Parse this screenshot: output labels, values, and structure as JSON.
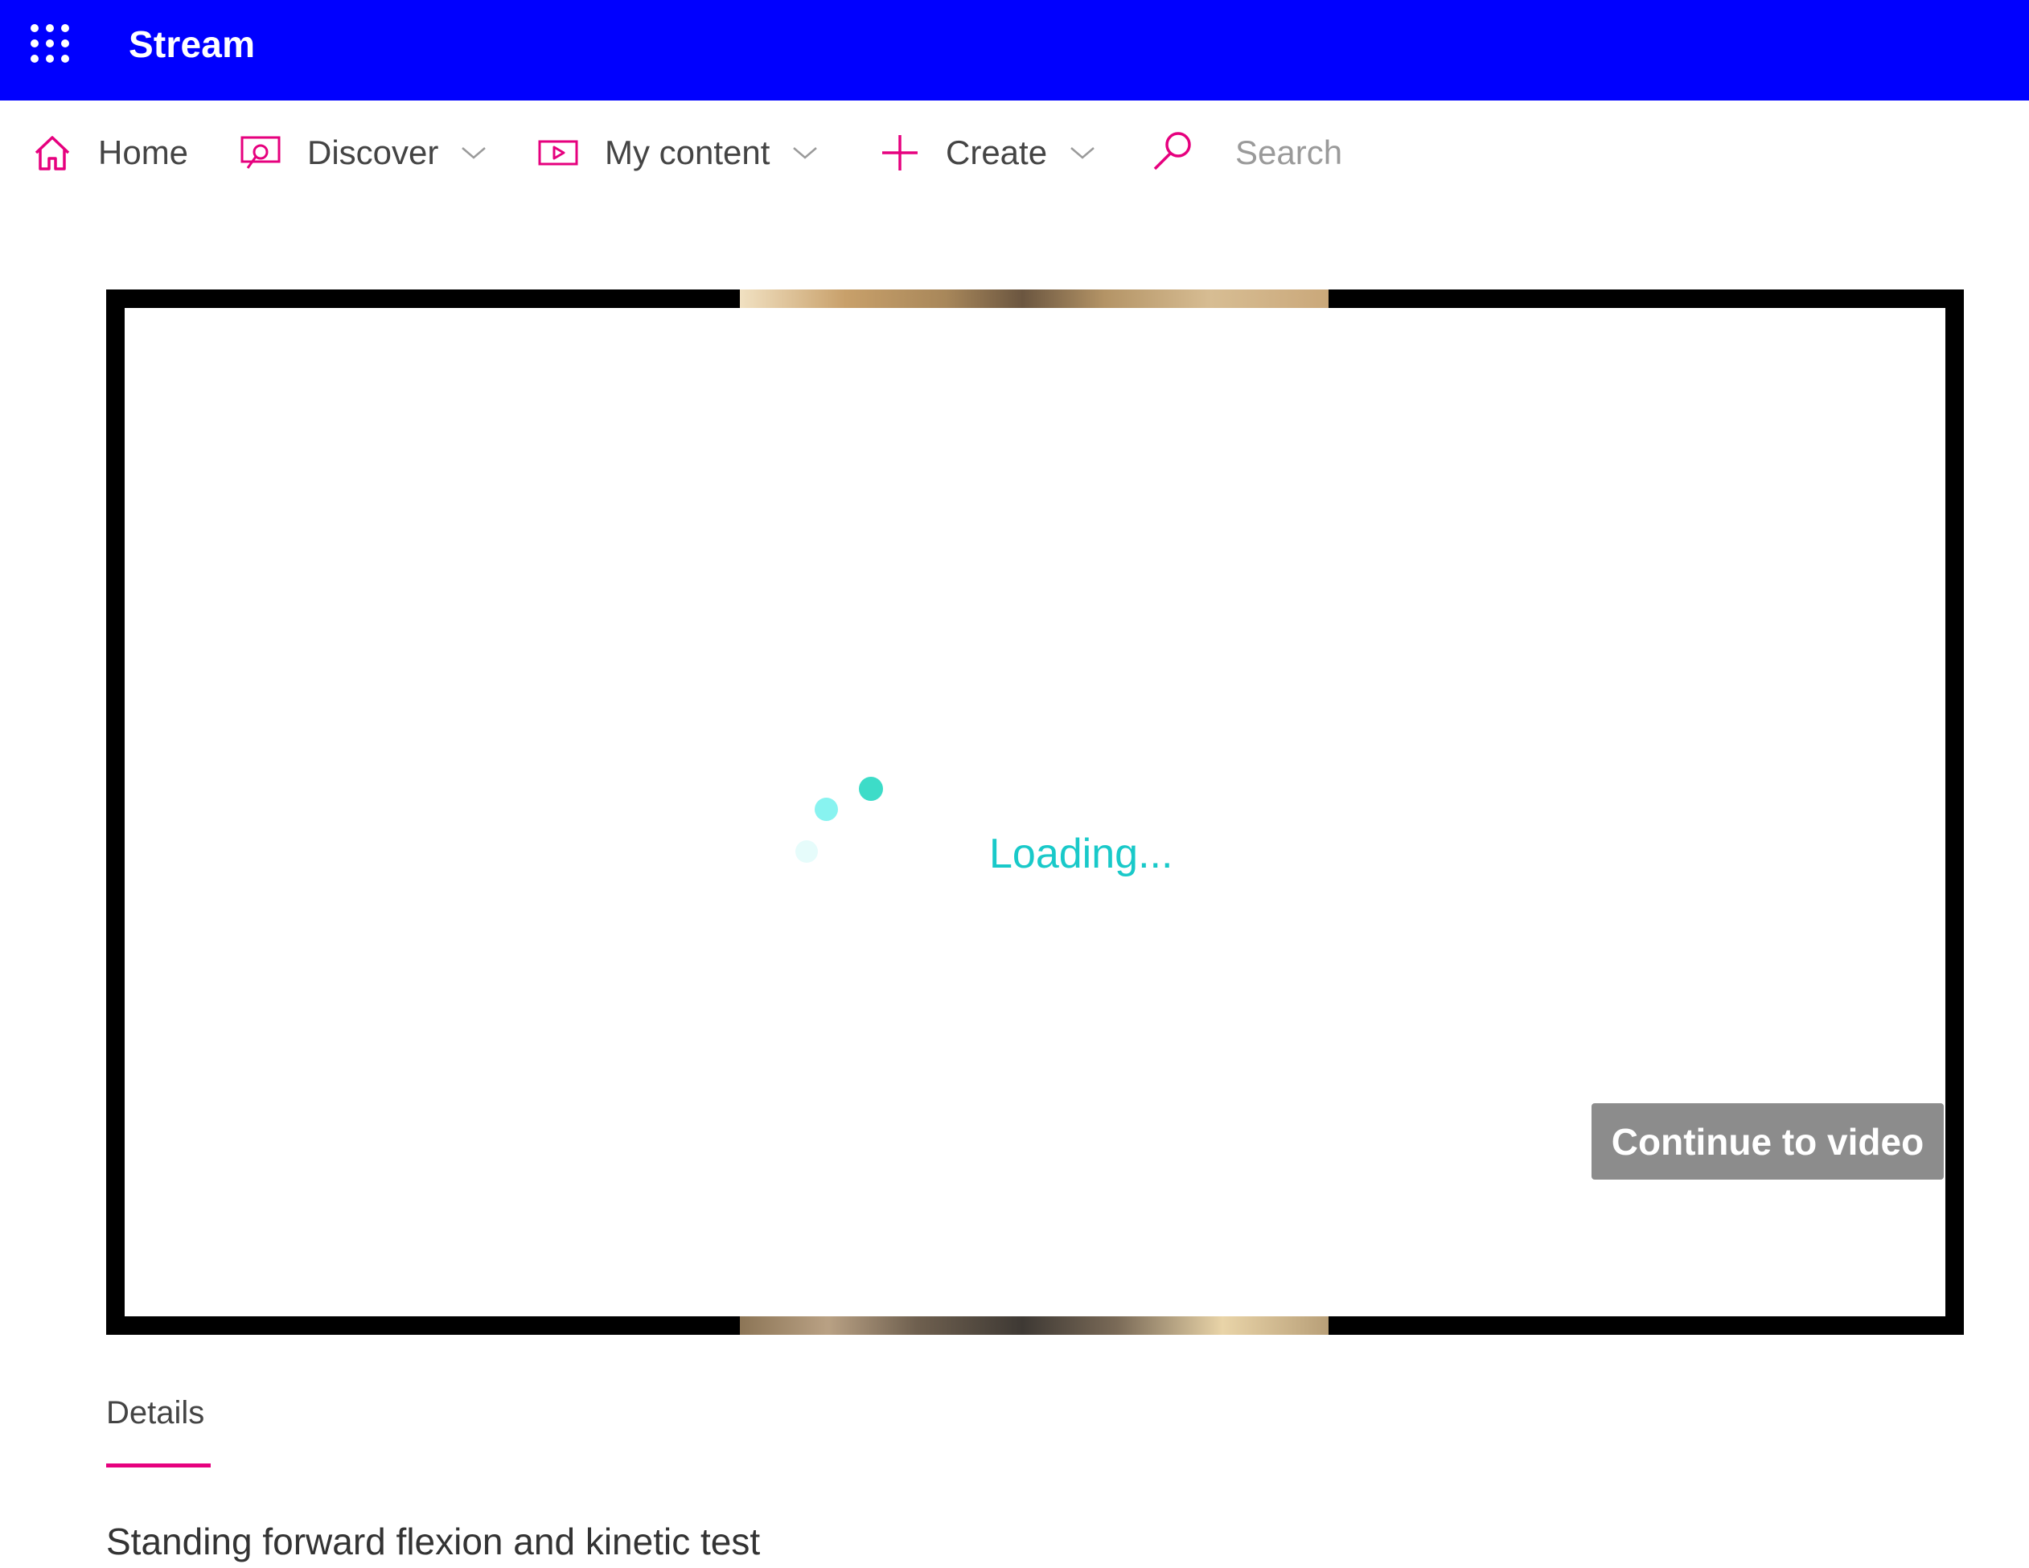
{
  "app": {
    "title": "Stream"
  },
  "colors": {
    "suite_bar": "#0000ff",
    "accent": "#e6007e",
    "loading": "#19c9c9",
    "button_bg": "#8c8c8c"
  },
  "nav": {
    "items": [
      {
        "label": "Home",
        "icon": "home-icon"
      },
      {
        "label": "Discover",
        "icon": "discover-icon"
      },
      {
        "label": "My content",
        "icon": "my-content-icon"
      },
      {
        "label": "Create",
        "icon": "plus-icon"
      }
    ],
    "search": {
      "placeholder": "Search",
      "icon": "search-icon"
    }
  },
  "player": {
    "loading_text": "Loading...",
    "continue_label": "Continue to video"
  },
  "details": {
    "tab_label": "Details",
    "video_title": "Standing forward flexion and kinetic test"
  }
}
